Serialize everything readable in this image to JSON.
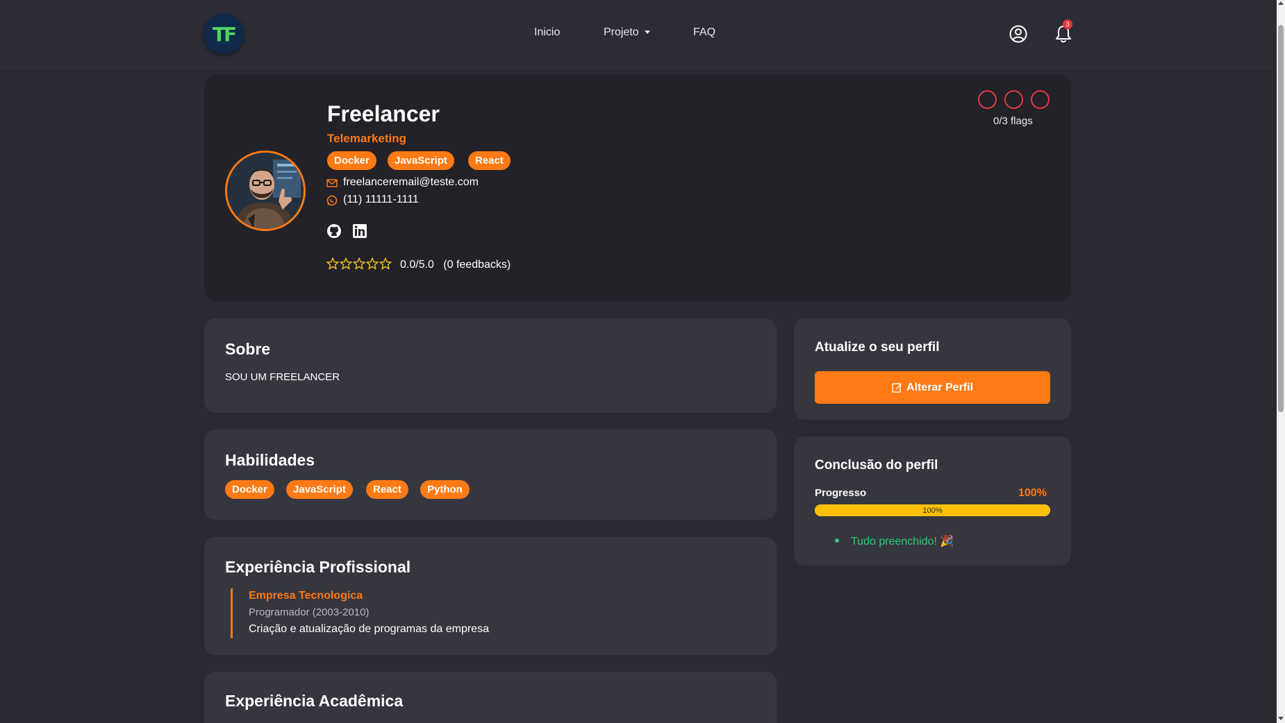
{
  "navbar": {
    "logo_text": "TF",
    "links": [
      {
        "label": "Inicio"
      },
      {
        "label": "Projeto"
      },
      {
        "label": "FAQ"
      }
    ],
    "notification_count": "3"
  },
  "profile": {
    "name": "Freelancer",
    "role": "Telemarketing",
    "tags": [
      "Docker",
      "JavaScript",
      "React"
    ],
    "email": "freelanceremail@teste.com",
    "phone": "(11) 11111-1111",
    "rating": "0.0/5.0",
    "rating_value": 0,
    "rating_max": 5,
    "feedbacks": "(0 feedbacks)",
    "flags_label": "0/3 flags",
    "flags_count": 0,
    "flags_max": 3
  },
  "sobre": {
    "title": "Sobre",
    "text": "SOU UM FREELANCER"
  },
  "habilidades": {
    "title": "Habilidades",
    "items": [
      "Docker",
      "JavaScript",
      "React",
      "Python"
    ]
  },
  "experiencia_profissional": {
    "title": "Experiência Profissional",
    "items": [
      {
        "company": "Empresa Tecnologica",
        "role": "Programador (2003-2010)",
        "description": "Criação e atualização de programas da empresa"
      }
    ]
  },
  "experiencia_academica": {
    "title": "Experiência Acadêmica"
  },
  "atualize": {
    "title": "Atualize o seu perfil",
    "button_label": "Alterar Perfil"
  },
  "conclusao": {
    "title": "Conclusão do perfil",
    "progress_label": "Progresso",
    "progress_pct": "100%",
    "progress_value": 100,
    "bar_label": "100%",
    "status_text": "Tudo preenchido! 🎉"
  },
  "colors": {
    "accent": "#ff7a14",
    "flag": "#e5384b",
    "success": "#2ecc71",
    "progress": "#ffc107"
  }
}
